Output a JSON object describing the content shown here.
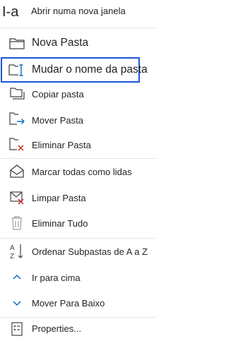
{
  "menu": {
    "items": [
      {
        "id": "open-new-window",
        "label": "Abrir numa nova janela"
      },
      {
        "id": "new-folder",
        "label": "Nova Pasta"
      },
      {
        "id": "rename-folder",
        "label": "Mudar o nome da pasta"
      },
      {
        "id": "copy-folder",
        "label": "Copiar pasta"
      },
      {
        "id": "move-folder",
        "label": "Mover Pasta"
      },
      {
        "id": "delete-folder",
        "label": "Eliminar Pasta"
      },
      {
        "id": "mark-all-read",
        "label": "Marcar todas como lidas"
      },
      {
        "id": "clean-folder",
        "label": "Limpar Pasta"
      },
      {
        "id": "delete-all",
        "label": "Eliminar Tudo"
      },
      {
        "id": "sort-subfolders",
        "label": "Ordenar Subpastas de A a Z"
      },
      {
        "id": "move-up",
        "label": "Ir para cima"
      },
      {
        "id": "move-down",
        "label": "Mover Para Baixo"
      },
      {
        "id": "properties",
        "label": "Properties..."
      }
    ]
  },
  "colors": {
    "highlight_border": "#1a56d6",
    "delete_red": "#c42b1c",
    "move_blue": "#0f6cbd",
    "icon_gray": "#424242"
  }
}
